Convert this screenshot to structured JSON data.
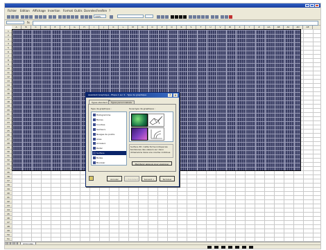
{
  "menu": [
    "Fichier",
    "Edition",
    "Affichage",
    "Insertion",
    "Format",
    "Outils",
    "Données",
    "Fenêtre",
    "?"
  ],
  "toolbar": {
    "zoom": "100%"
  },
  "formula_bar": {
    "fx": "fx"
  },
  "columns": [
    "A",
    "B",
    "C",
    "D",
    "E",
    "F",
    "G",
    "H",
    "I",
    "J",
    "K",
    "L",
    "M",
    "N",
    "O",
    "P",
    "Q",
    "R",
    "S",
    "T",
    "U",
    "V",
    "W",
    "X",
    "Y",
    "Z",
    "AA",
    "AB",
    "AC",
    "AD",
    "AE"
  ],
  "sheet_tab": "Ampoules",
  "dialog": {
    "title": "Assistant Graphique - Étape 1 sur 4 - Type de graphique",
    "help": "?",
    "close": "×",
    "tabs": [
      "Types standard",
      "Types personnalisés"
    ],
    "type_label": "Type de graphique :",
    "subtype_label": "Sous-type de graphique :",
    "types": [
      "Histogramme",
      "Barres",
      "Courbes",
      "Secteurs",
      "Nuages de points",
      "Aires",
      "Anneaux",
      "Radar",
      "Surface",
      "Bulles",
      "Boursier"
    ],
    "selected_type_index": 8,
    "description": "Surface 3D. Cette forme indique les tendances des valeurs sur deux dimensions dans une courbe continue.",
    "preview_button": "Maintenir appuyé pour visionner",
    "buttons": {
      "cancel": "Annuler",
      "back": "< Précédent",
      "next": "Suivant >",
      "finish": "Terminer"
    }
  },
  "colors": {
    "selection": "#3b3f63",
    "titlebar": "#1b3f9e",
    "dialog_selected": "#0a246a"
  }
}
